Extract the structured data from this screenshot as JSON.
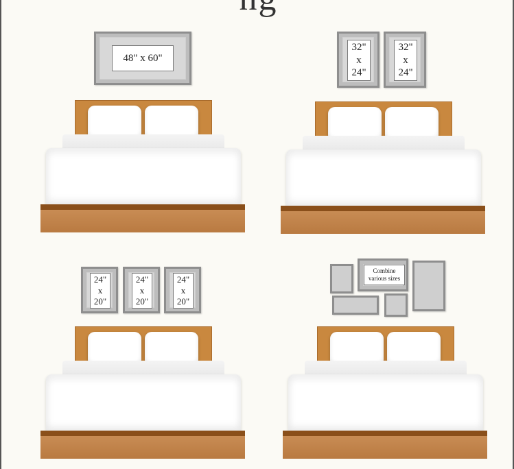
{
  "header": {
    "title": "ng"
  },
  "layouts": {
    "single": {
      "label": "48\" x 60\""
    },
    "pair": {
      "labels": [
        "32\"\nx\n24\"",
        "32\"\nx\n24\""
      ]
    },
    "triple": {
      "labels": [
        "24\"\nx\n20\"",
        "24\"\nx\n20\"",
        "24\"\nx\n20\""
      ]
    },
    "gallery": {
      "label": "Combine\nvarious sizes"
    }
  }
}
